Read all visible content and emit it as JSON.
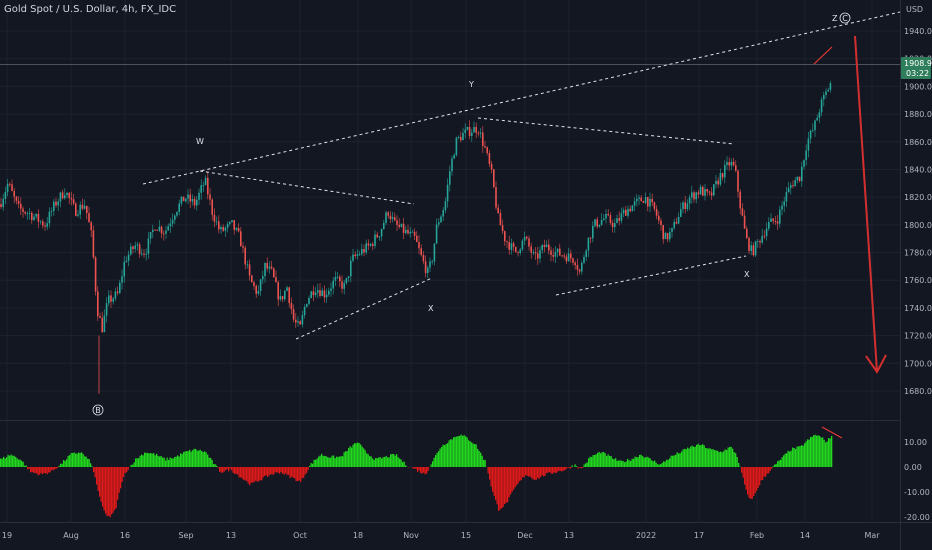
{
  "title": "Gold Spot / U.S. Dollar, 4h, FX_IDC",
  "currency": "USD",
  "price_label": "1908.95",
  "time_label": "03:22",
  "chart_data": {
    "type": "candlestick",
    "price_axis": {
      "ticks": [
        "1940.00",
        "1920.00",
        "1900.00",
        "1880.00",
        "1860.00",
        "1840.00",
        "1820.00",
        "1800.00",
        "1780.00",
        "1760.00",
        "1740.00",
        "1720.00",
        "1700.00",
        "1680.00"
      ],
      "range": [
        1668,
        1952
      ]
    },
    "x_ticks": [
      "19",
      "Aug",
      "16",
      "Sep",
      "13",
      "Oct",
      "18",
      "Nov",
      "15",
      "Dec",
      "13",
      "2022",
      "17",
      "Feb",
      "14",
      "Mar"
    ],
    "path_points": [
      [
        0,
        1815
      ],
      [
        8,
        1830
      ],
      [
        18,
        1812
      ],
      [
        30,
        1808
      ],
      [
        45,
        1800
      ],
      [
        55,
        1815
      ],
      [
        65,
        1825
      ],
      [
        75,
        1810
      ],
      [
        85,
        1815
      ],
      [
        92,
        1790
      ],
      [
        97,
        1740
      ],
      [
        102,
        1725
      ],
      [
        108,
        1745
      ],
      [
        118,
        1750
      ],
      [
        125,
        1775
      ],
      [
        135,
        1785
      ],
      [
        145,
        1780
      ],
      [
        155,
        1800
      ],
      [
        165,
        1795
      ],
      [
        175,
        1810
      ],
      [
        185,
        1820
      ],
      [
        195,
        1815
      ],
      [
        205,
        1832
      ],
      [
        212,
        1810
      ],
      [
        220,
        1795
      ],
      [
        232,
        1800
      ],
      [
        240,
        1790
      ],
      [
        250,
        1760
      ],
      [
        258,
        1750
      ],
      [
        265,
        1770
      ],
      [
        272,
        1765
      ],
      [
        280,
        1745
      ],
      [
        287,
        1755
      ],
      [
        294,
        1730
      ],
      [
        300,
        1725
      ],
      [
        306,
        1745
      ],
      [
        315,
        1755
      ],
      [
        325,
        1750
      ],
      [
        335,
        1760
      ],
      [
        345,
        1755
      ],
      [
        352,
        1775
      ],
      [
        360,
        1780
      ],
      [
        370,
        1785
      ],
      [
        380,
        1795
      ],
      [
        388,
        1810
      ],
      [
        395,
        1800
      ],
      [
        405,
        1795
      ],
      [
        415,
        1790
      ],
      [
        422,
        1775
      ],
      [
        428,
        1765
      ],
      [
        432,
        1775
      ],
      [
        437,
        1800
      ],
      [
        445,
        1815
      ],
      [
        450,
        1840
      ],
      [
        456,
        1860
      ],
      [
        462,
        1865
      ],
      [
        470,
        1868
      ],
      [
        478,
        1870
      ],
      [
        485,
        1855
      ],
      [
        492,
        1835
      ],
      [
        498,
        1805
      ],
      [
        505,
        1790
      ],
      [
        515,
        1780
      ],
      [
        525,
        1790
      ],
      [
        535,
        1775
      ],
      [
        545,
        1785
      ],
      [
        555,
        1780
      ],
      [
        565,
        1778
      ],
      [
        575,
        1775
      ],
      [
        580,
        1765
      ],
      [
        586,
        1785
      ],
      [
        594,
        1800
      ],
      [
        605,
        1805
      ],
      [
        615,
        1800
      ],
      [
        625,
        1810
      ],
      [
        635,
        1815
      ],
      [
        645,
        1820
      ],
      [
        655,
        1810
      ],
      [
        665,
        1790
      ],
      [
        672,
        1795
      ],
      [
        680,
        1810
      ],
      [
        690,
        1820
      ],
      [
        700,
        1825
      ],
      [
        710,
        1820
      ],
      [
        720,
        1835
      ],
      [
        730,
        1845
      ],
      [
        735,
        1840
      ],
      [
        740,
        1815
      ],
      [
        746,
        1790
      ],
      [
        752,
        1780
      ],
      [
        760,
        1790
      ],
      [
        768,
        1800
      ],
      [
        778,
        1805
      ],
      [
        785,
        1820
      ],
      [
        792,
        1830
      ],
      [
        800,
        1835
      ],
      [
        807,
        1860
      ],
      [
        814,
        1870
      ],
      [
        820,
        1885
      ],
      [
        826,
        1895
      ],
      [
        832,
        1905
      ]
    ],
    "oscillator": {
      "ticks": [
        "10.00",
        "0.00",
        "-10.00",
        "-20.00"
      ],
      "range": [
        -22,
        14
      ],
      "points": [
        [
          0,
          3
        ],
        [
          10,
          5
        ],
        [
          20,
          3
        ],
        [
          30,
          -2
        ],
        [
          40,
          -3
        ],
        [
          50,
          -2
        ],
        [
          60,
          1
        ],
        [
          70,
          5
        ],
        [
          80,
          6
        ],
        [
          90,
          2
        ],
        [
          95,
          -5
        ],
        [
          100,
          -14
        ],
        [
          105,
          -19
        ],
        [
          110,
          -20
        ],
        [
          115,
          -17
        ],
        [
          120,
          -8
        ],
        [
          125,
          -2
        ],
        [
          135,
          3
        ],
        [
          145,
          6
        ],
        [
          155,
          5
        ],
        [
          165,
          3
        ],
        [
          175,
          4
        ],
        [
          185,
          6
        ],
        [
          195,
          7
        ],
        [
          205,
          6
        ],
        [
          212,
          2
        ],
        [
          220,
          -2
        ],
        [
          230,
          -1
        ],
        [
          240,
          -4
        ],
        [
          250,
          -7
        ],
        [
          260,
          -5
        ],
        [
          270,
          -3
        ],
        [
          280,
          -2
        ],
        [
          290,
          -4
        ],
        [
          300,
          -6
        ],
        [
          310,
          1
        ],
        [
          320,
          5
        ],
        [
          330,
          4
        ],
        [
          340,
          4
        ],
        [
          350,
          8
        ],
        [
          357,
          10
        ],
        [
          365,
          6
        ],
        [
          375,
          3
        ],
        [
          385,
          4
        ],
        [
          395,
          5
        ],
        [
          405,
          1
        ],
        [
          415,
          -1
        ],
        [
          425,
          -3
        ],
        [
          430,
          1
        ],
        [
          440,
          8
        ],
        [
          450,
          11
        ],
        [
          458,
          13
        ],
        [
          465,
          12
        ],
        [
          475,
          9
        ],
        [
          485,
          2
        ],
        [
          492,
          -10
        ],
        [
          498,
          -17
        ],
        [
          505,
          -15
        ],
        [
          515,
          -8
        ],
        [
          525,
          -3
        ],
        [
          535,
          -5
        ],
        [
          545,
          -3
        ],
        [
          555,
          -2
        ],
        [
          565,
          -1
        ],
        [
          575,
          1
        ],
        [
          580,
          -1
        ],
        [
          590,
          4
        ],
        [
          600,
          6
        ],
        [
          610,
          4
        ],
        [
          620,
          2
        ],
        [
          630,
          3
        ],
        [
          640,
          5
        ],
        [
          650,
          3
        ],
        [
          660,
          1
        ],
        [
          670,
          4
        ],
        [
          680,
          6
        ],
        [
          690,
          8
        ],
        [
          700,
          9
        ],
        [
          710,
          7
        ],
        [
          720,
          6
        ],
        [
          730,
          8
        ],
        [
          736,
          5
        ],
        [
          742,
          -4
        ],
        [
          748,
          -13
        ],
        [
          753,
          -12
        ],
        [
          760,
          -6
        ],
        [
          770,
          -1
        ],
        [
          780,
          3
        ],
        [
          790,
          7
        ],
        [
          800,
          8
        ],
        [
          808,
          11
        ],
        [
          815,
          13
        ],
        [
          820,
          12
        ],
        [
          826,
          10
        ],
        [
          832,
          13
        ]
      ]
    },
    "wave_labels": [
      "W",
      "Y",
      "X",
      "X",
      "Z",
      "C",
      "B"
    ],
    "forecast": "down"
  }
}
